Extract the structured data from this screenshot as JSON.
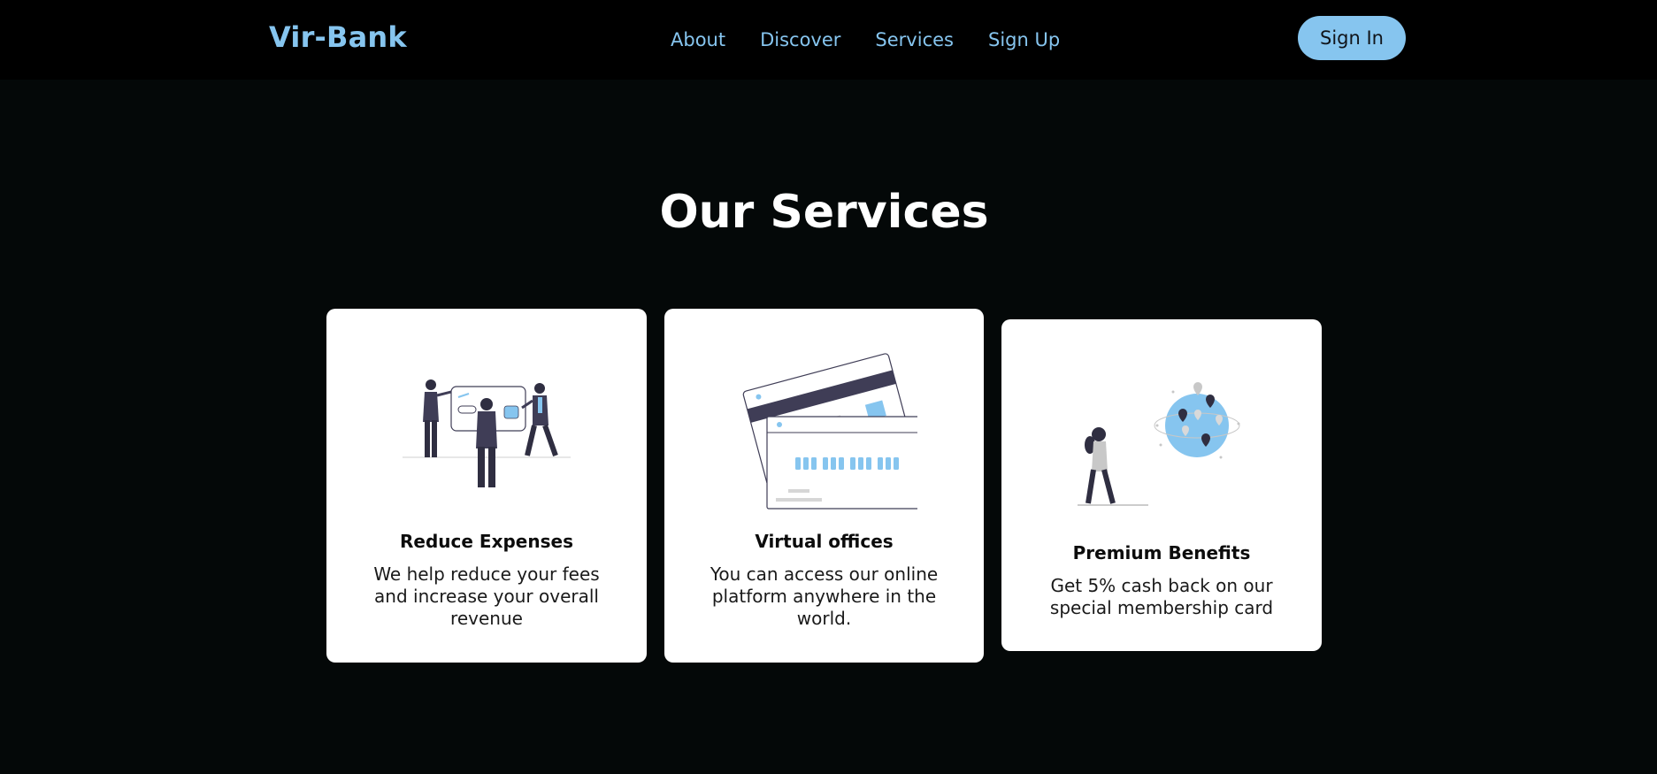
{
  "nav": {
    "logo": "Vir-Bank",
    "links": [
      "About",
      "Discover",
      "Services",
      "Sign Up"
    ],
    "signin_label": "Sign In"
  },
  "services": {
    "title": "Our Services",
    "cards": [
      {
        "title": "Reduce Expenses",
        "description": "We help reduce your fees and increase your overall revenue",
        "illustration": "team-presentation-illustration"
      },
      {
        "title": "Virtual offices",
        "description": "You can access our online platform anywhere in the world.",
        "illustration": "credit-cards-illustration"
      },
      {
        "title": "Premium Benefits",
        "description": "Get 5% cash back on our special membership card",
        "illustration": "globe-locations-illustration"
      }
    ]
  },
  "colors": {
    "background": "#040808",
    "navbar": "#000000",
    "accent": "#86c5ef",
    "card": "#ffffff",
    "illustration_dark": "#3f3d56"
  }
}
